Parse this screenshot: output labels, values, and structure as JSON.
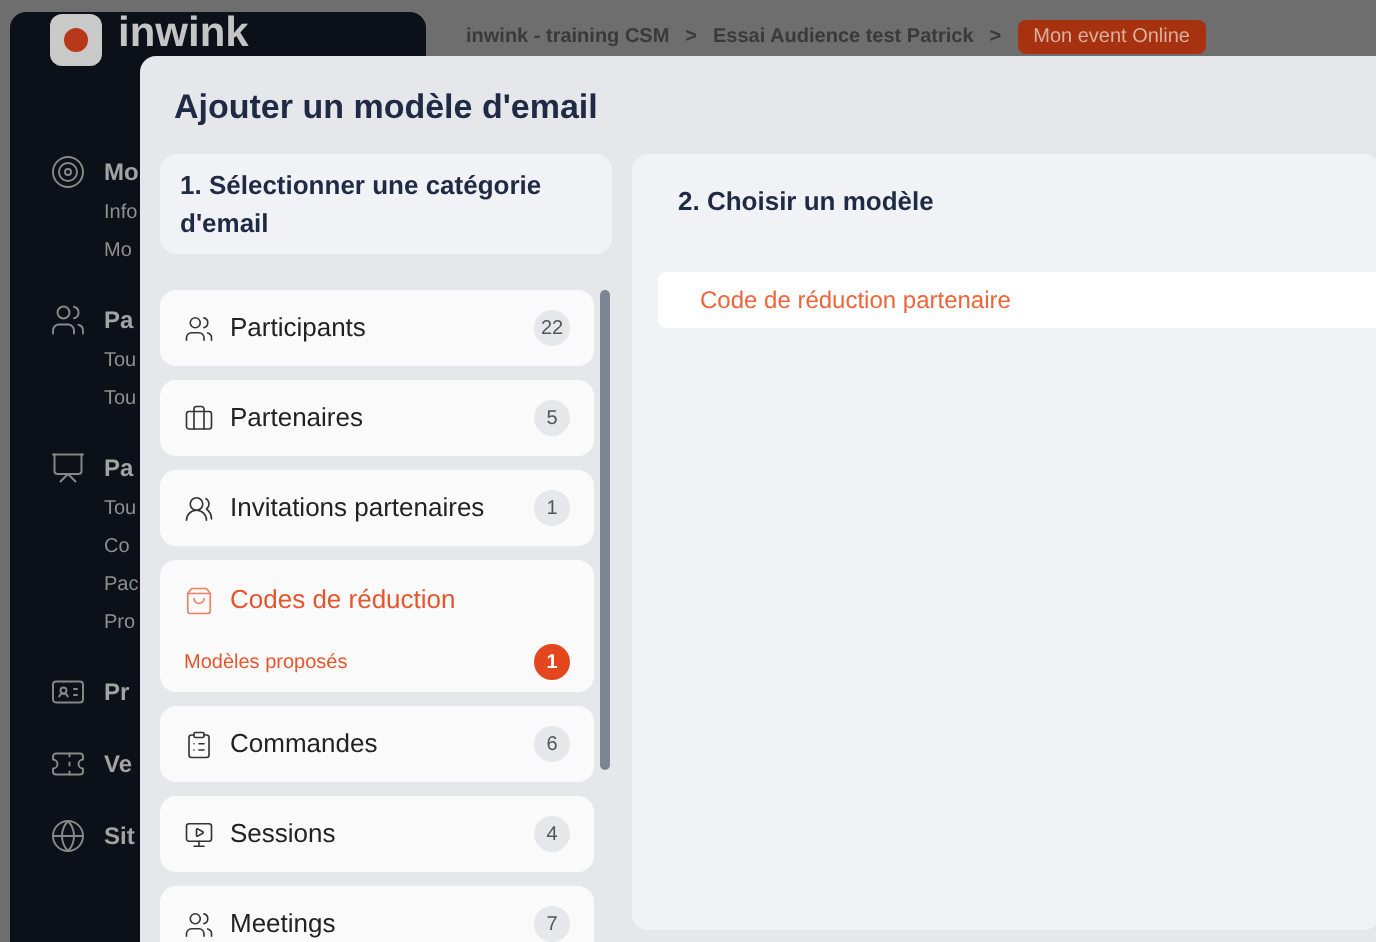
{
  "app": {
    "logo_text": "inwink"
  },
  "breadcrumb": {
    "items": [
      "inwink - training CSM",
      "Essai Audience test Patrick"
    ],
    "separator": ">",
    "badge": "Mon event Online"
  },
  "sidebar": {
    "sections": [
      {
        "title": "Mo",
        "links": [
          "Info",
          "Mo"
        ]
      },
      {
        "title": "Pa",
        "links": [
          "Tou",
          "Tou"
        ]
      },
      {
        "title": "Pa",
        "links": [
          "Tou",
          "Co",
          "Pac",
          "Pro"
        ]
      },
      {
        "title": "Pr"
      },
      {
        "title": "Ve"
      },
      {
        "title": "Sit"
      }
    ]
  },
  "modal": {
    "title": "Ajouter un modèle d'email",
    "step1": {
      "title": "1. Sélectionner une catégorie d'email"
    },
    "categories": [
      {
        "label": "Participants",
        "count": "22",
        "selected": false
      },
      {
        "label": "Partenaires",
        "count": "5",
        "selected": false
      },
      {
        "label": "Invitations partenaires",
        "count": "1",
        "selected": false
      },
      {
        "label": "Codes de réduction",
        "count": "1",
        "selected": true,
        "sub_label": "Modèles proposés"
      },
      {
        "label": "Commandes",
        "count": "6",
        "selected": false
      },
      {
        "label": "Sessions",
        "count": "4",
        "selected": false
      },
      {
        "label": "Meetings",
        "count": "7",
        "selected": false
      }
    ],
    "step2": {
      "title": "2. Choisir un modèle",
      "templates": [
        "Code de réduction partenaire"
      ]
    }
  }
}
